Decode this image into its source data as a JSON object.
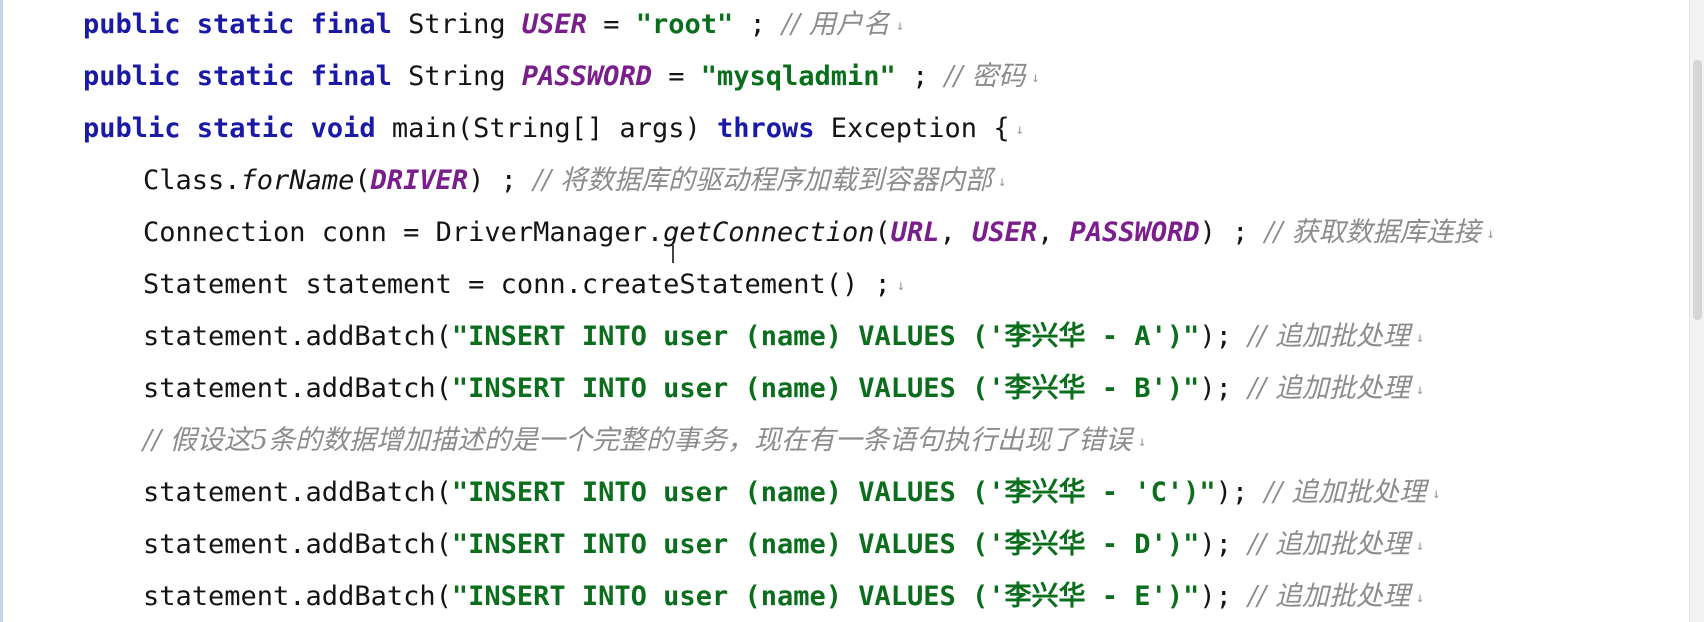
{
  "lines": [
    {
      "tokens": [
        {
          "t": "public static final ",
          "c": "kw"
        },
        {
          "t": "String ",
          "c": ""
        },
        {
          "t": "USER",
          "c": "const"
        },
        {
          "t": " = ",
          "c": ""
        },
        {
          "t": "\"root\"",
          "c": "str"
        },
        {
          "t": " ; ",
          "c": ""
        },
        {
          "t": "// 用户名",
          "c": "cm"
        }
      ]
    },
    {
      "tokens": [
        {
          "t": "public static final ",
          "c": "kw"
        },
        {
          "t": "String ",
          "c": ""
        },
        {
          "t": "PASSWORD",
          "c": "const"
        },
        {
          "t": " = ",
          "c": ""
        },
        {
          "t": "\"mysqladmin\"",
          "c": "str"
        },
        {
          "t": " ; ",
          "c": ""
        },
        {
          "t": "// 密码",
          "c": "cm"
        }
      ]
    },
    {
      "tokens": [
        {
          "t": "public static void ",
          "c": "kw"
        },
        {
          "t": "main(String[] args) ",
          "c": ""
        },
        {
          "t": "throws ",
          "c": "kw"
        },
        {
          "t": "Exception {",
          "c": ""
        }
      ]
    },
    {
      "tokens": [
        {
          "t": "Class.",
          "c": ""
        },
        {
          "t": "forName",
          "c": "method-it"
        },
        {
          "t": "(",
          "c": ""
        },
        {
          "t": "DRIVER",
          "c": "const"
        },
        {
          "t": ") ; ",
          "c": ""
        },
        {
          "t": "// 将数据库的驱动程序加载到容器内部",
          "c": "cm"
        }
      ]
    },
    {
      "tokens": [
        {
          "t": "Connection conn = DriverManager.",
          "c": ""
        },
        {
          "t": "getConnection",
          "c": "method-it"
        },
        {
          "t": "(",
          "c": ""
        },
        {
          "t": "URL",
          "c": "const"
        },
        {
          "t": ", ",
          "c": ""
        },
        {
          "t": "USER",
          "c": "const"
        },
        {
          "t": ", ",
          "c": ""
        },
        {
          "t": "PASSWORD",
          "c": "const"
        },
        {
          "t": ") ; ",
          "c": ""
        },
        {
          "t": "// 获取数据库连接",
          "c": "cm"
        }
      ]
    },
    {
      "tokens": [
        {
          "t": "Statement statement = conn.createStatement() ;",
          "c": ""
        }
      ]
    },
    {
      "tokens": [
        {
          "t": "statement.addBatch(",
          "c": ""
        },
        {
          "t": "\"INSERT INTO user (name) VALUES ('李兴华 - A')\"",
          "c": "str"
        },
        {
          "t": "); ",
          "c": ""
        },
        {
          "t": "// 追加批处理",
          "c": "cm"
        }
      ]
    },
    {
      "tokens": [
        {
          "t": "statement.addBatch(",
          "c": ""
        },
        {
          "t": "\"INSERT INTO user (name) VALUES ('李兴华 - B')\"",
          "c": "str"
        },
        {
          "t": "); ",
          "c": ""
        },
        {
          "t": "// 追加批处理",
          "c": "cm"
        }
      ]
    },
    {
      "tokens": [
        {
          "t": "// 假设这5条的数据增加描述的是一个完整的事务，现在有一条语句执行出现了错误",
          "c": "cm"
        }
      ]
    },
    {
      "tokens": [
        {
          "t": "statement.addBatch(",
          "c": ""
        },
        {
          "t": "\"INSERT INTO user (name) VALUES ('李兴华 - 'C')\"",
          "c": "str"
        },
        {
          "t": "); ",
          "c": ""
        },
        {
          "t": "// 追加批处理",
          "c": "cm"
        }
      ]
    },
    {
      "tokens": [
        {
          "t": "statement.addBatch(",
          "c": ""
        },
        {
          "t": "\"INSERT INTO user (name) VALUES ('李兴华 - D')\"",
          "c": "str"
        },
        {
          "t": "); ",
          "c": ""
        },
        {
          "t": "// 追加批处理",
          "c": "cm"
        }
      ]
    },
    {
      "tokens": [
        {
          "t": "statement.addBatch(",
          "c": ""
        },
        {
          "t": "\"INSERT INTO user (name) VALUES ('李兴华 - E')\"",
          "c": "str"
        },
        {
          "t": "); ",
          "c": ""
        },
        {
          "t": "// 追加批处理",
          "c": "cm"
        }
      ]
    }
  ]
}
